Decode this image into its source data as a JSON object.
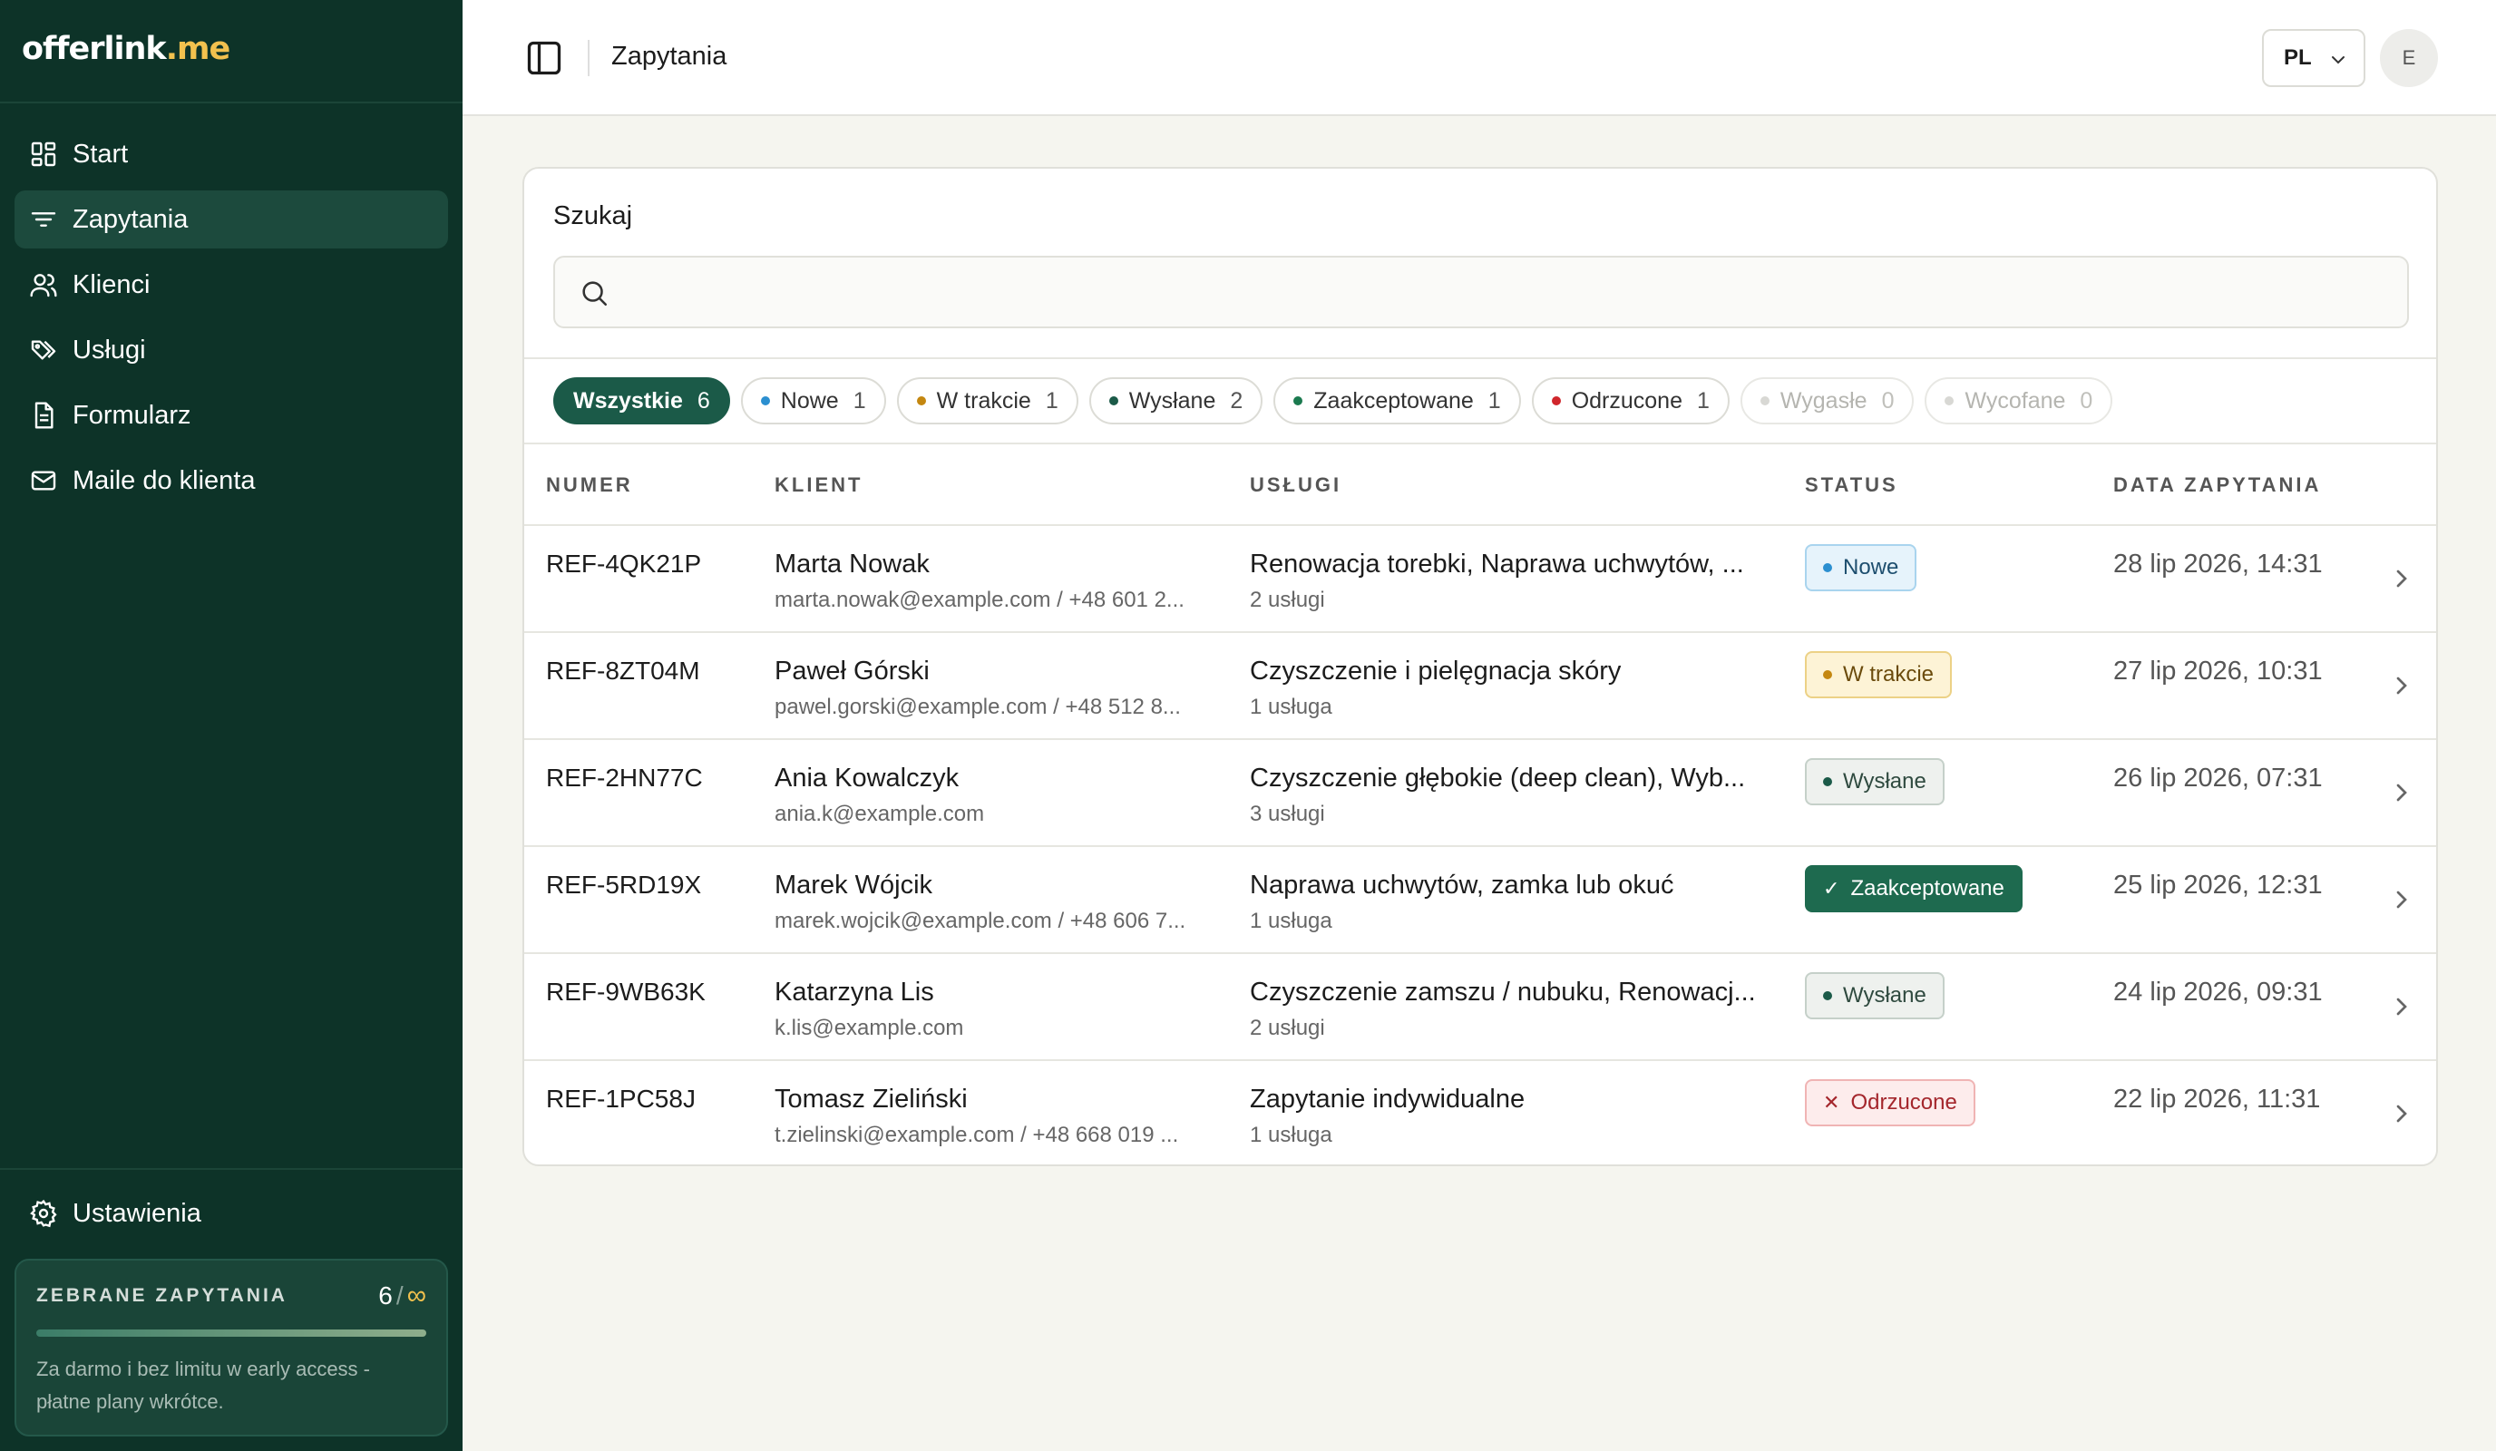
{
  "brand": {
    "name": "offerlink",
    "tld": ".me"
  },
  "sidebar": {
    "items": [
      {
        "label": "Start",
        "icon": "dashboard-icon"
      },
      {
        "label": "Zapytania",
        "icon": "filter-lines-icon"
      },
      {
        "label": "Klienci",
        "icon": "users-icon"
      },
      {
        "label": "Usługi",
        "icon": "tags-icon"
      },
      {
        "label": "Formularz",
        "icon": "document-icon"
      },
      {
        "label": "Maile do klienta",
        "icon": "mail-icon"
      }
    ],
    "active_index": 1,
    "settings_label": "Ustawienia",
    "quota": {
      "title": "ZEBRANE ZAPYTANIA",
      "count": "6",
      "separator": "/",
      "limit": "∞",
      "fill_fraction": 1.0,
      "note": "Za darmo i bez limitu w early access - płatne plany wkrótce."
    }
  },
  "topbar": {
    "title": "Zapytania",
    "language": "PL",
    "avatar_initial": "E"
  },
  "search": {
    "label": "Szukaj",
    "value": "",
    "placeholder": ""
  },
  "filters": [
    {
      "label": "Wszystkie",
      "count": "6",
      "dot": null,
      "state": "active"
    },
    {
      "label": "Nowe",
      "count": "1",
      "dot": "#2b8fd0",
      "state": "normal"
    },
    {
      "label": "W trakcie",
      "count": "1",
      "dot": "#c48710",
      "state": "normal"
    },
    {
      "label": "Wysłane",
      "count": "2",
      "dot": "#1b5a48",
      "state": "normal"
    },
    {
      "label": "Zaakceptowane",
      "count": "1",
      "dot": "#1b7a4f",
      "state": "normal"
    },
    {
      "label": "Odrzucone",
      "count": "1",
      "dot": "#d0262c",
      "state": "normal"
    },
    {
      "label": "Wygasłe",
      "count": "0",
      "dot": "#d8d8d4",
      "state": "muted"
    },
    {
      "label": "Wycofane",
      "count": "0",
      "dot": "#d8d8d4",
      "state": "muted"
    }
  ],
  "table": {
    "headers": {
      "number": "NUMER",
      "client": "KLIENT",
      "services": "USŁUGI",
      "status": "STATUS",
      "date": "DATA ZAPYTANIA"
    },
    "rows": [
      {
        "number": "REF-4QK21P",
        "client": "Marta Nowak",
        "contact": "marta.nowak@example.com / +48 601 2...",
        "services": "Renowacja torebki, Naprawa uchwytów, ...",
        "count": "2 usługi",
        "status": "Nowe",
        "status_kind": "new",
        "date": "28 lip 2026, 14:31"
      },
      {
        "number": "REF-8ZT04M",
        "client": "Paweł Górski",
        "contact": "pawel.gorski@example.com / +48 512 8...",
        "services": "Czyszczenie i pielęgnacja skóry",
        "count": "1 usługa",
        "status": "W trakcie",
        "status_kind": "prog",
        "date": "27 lip 2026, 10:31"
      },
      {
        "number": "REF-2HN77C",
        "client": "Ania Kowalczyk",
        "contact": "ania.k@example.com",
        "services": "Czyszczenie głębokie (deep clean), Wyb...",
        "count": "3 usługi",
        "status": "Wysłane",
        "status_kind": "sent",
        "date": "26 lip 2026, 07:31"
      },
      {
        "number": "REF-5RD19X",
        "client": "Marek Wójcik",
        "contact": "marek.wojcik@example.com / +48 606 7...",
        "services": "Naprawa uchwytów, zamka lub okuć",
        "count": "1 usługa",
        "status": "Zaakceptowane",
        "status_kind": "acc",
        "date": "25 lip 2026, 12:31"
      },
      {
        "number": "REF-9WB63K",
        "client": "Katarzyna Lis",
        "contact": "k.lis@example.com",
        "services": "Czyszczenie zamszu / nubuku, Renowacj...",
        "count": "2 usługi",
        "status": "Wysłane",
        "status_kind": "sent",
        "date": "24 lip 2026, 09:31"
      },
      {
        "number": "REF-1PC58J",
        "client": "Tomasz Zieliński",
        "contact": "t.zielinski@example.com / +48 668 019 ...",
        "services": "Zapytanie indywidualne",
        "count": "1 usługa",
        "status": "Odrzucone",
        "status_kind": "rej",
        "date": "22 lip 2026, 11:31"
      }
    ]
  }
}
